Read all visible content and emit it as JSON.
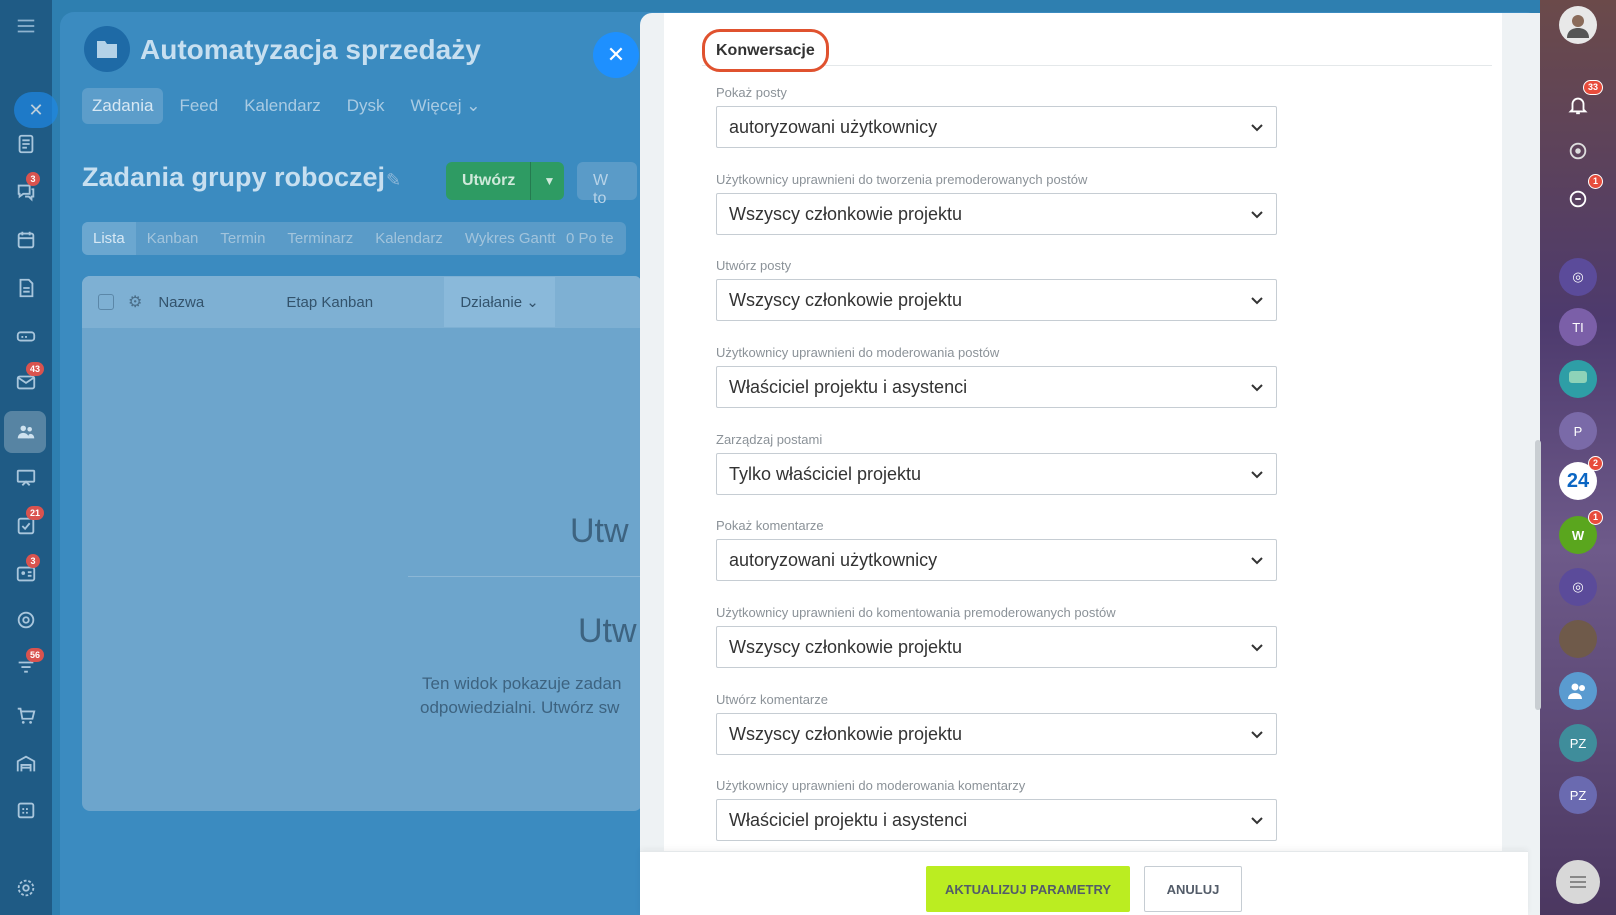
{
  "left_sidebar": {
    "badges": {
      "chat": "3",
      "mail": "43",
      "tasks": "21",
      "contacts": "3",
      "filter": "56"
    }
  },
  "background_page": {
    "title": "Automatyzacja sprzedaży",
    "tabs": [
      "Zadania",
      "Feed",
      "Kalendarz",
      "Dysk",
      "Więcej"
    ],
    "heading": "Zadania grupy roboczej",
    "create_button": "Utwórz",
    "search_placeholder": "W to",
    "views": [
      "Lista",
      "Kanban",
      "Termin",
      "Terminarz",
      "Kalendarz",
      "Wykres Gantta"
    ],
    "filter_count": "0",
    "filter_label": "Po te",
    "table_headers": {
      "name": "Nazwa",
      "stage": "Etap Kanban",
      "action": "Działanie"
    },
    "empty_text_1": "Utw",
    "empty_text_2": "Utw",
    "empty_desc_1": "Ten widok pokazuje zadan",
    "empty_desc_2": "odpowiedzialni. Utwórz sw"
  },
  "right_sidebar": {
    "badges": {
      "notifications": "33",
      "chat": "1",
      "app24": "2",
      "w": "1"
    },
    "avatars": [
      "TI",
      "P",
      "24",
      "W",
      "PZ",
      "PZ"
    ]
  },
  "panel": {
    "section_title": "Konwersacje",
    "fields": [
      {
        "label": "Pokaż posty",
        "value": "autoryzowani użytkownicy"
      },
      {
        "label": "Użytkownicy uprawnieni do tworzenia premoderowanych postów",
        "value": "Wszyscy członkowie projektu"
      },
      {
        "label": "Utwórz posty",
        "value": "Wszyscy członkowie projektu"
      },
      {
        "label": "Użytkownicy uprawnieni do moderowania postów",
        "value": "Właściciel projektu i asystenci"
      },
      {
        "label": "Zarządzaj postami",
        "value": "Tylko właściciel projektu"
      },
      {
        "label": "Pokaż komentarze",
        "value": "autoryzowani użytkownicy"
      },
      {
        "label": "Użytkownicy uprawnieni do komentowania premoderowanych postów",
        "value": "Wszyscy członkowie projektu"
      },
      {
        "label": "Utwórz komentarze",
        "value": "Wszyscy członkowie projektu"
      },
      {
        "label": "Użytkownicy uprawnieni do moderowania komentarzy",
        "value": "Właściciel projektu i asystenci"
      }
    ]
  },
  "footer": {
    "update_label": "AKTUALIZUJ PARAMETRY",
    "cancel_label": "ANULUJ"
  },
  "colors": {
    "highlight_border": "#e0522f",
    "update_button": "#bbed21"
  }
}
